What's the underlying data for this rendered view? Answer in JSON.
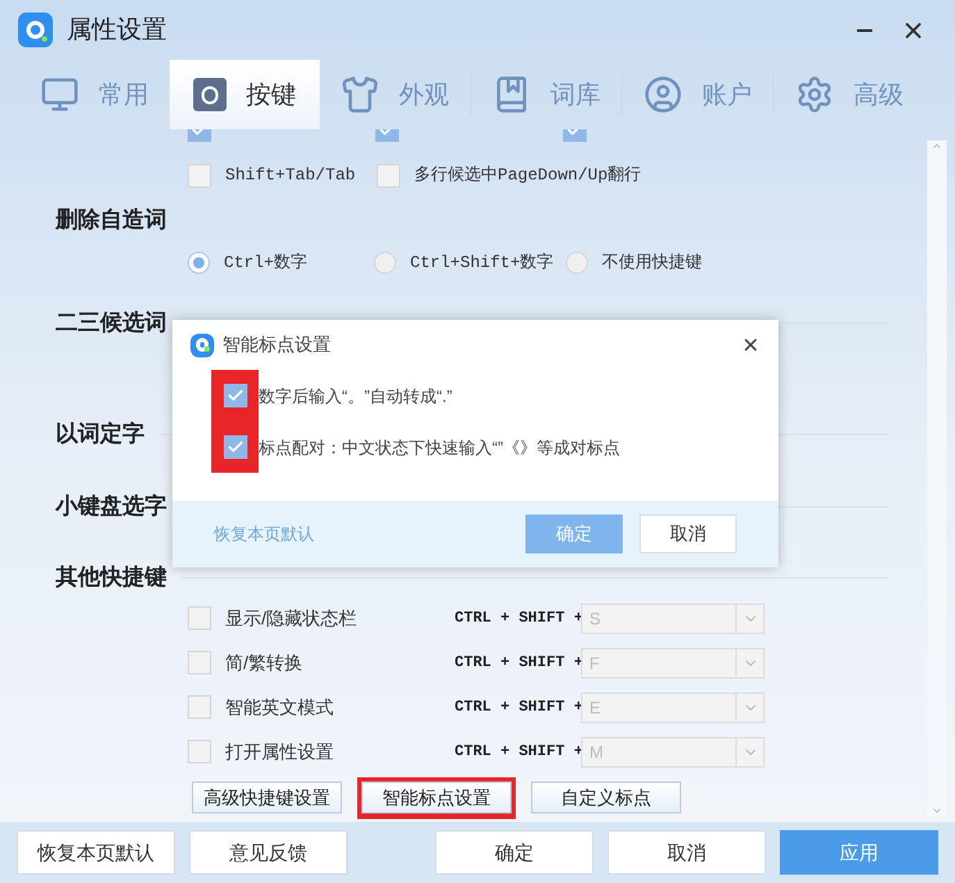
{
  "window": {
    "title": "属性设置"
  },
  "tabs": [
    {
      "label": "常用",
      "kind": "monitor",
      "selected": false
    },
    {
      "label": "按键",
      "kind": "keys",
      "selected": true
    },
    {
      "label": "外观",
      "kind": "theme",
      "selected": false
    },
    {
      "label": "词库",
      "kind": "dictionary",
      "selected": false
    },
    {
      "label": "账户",
      "kind": "account",
      "selected": false
    },
    {
      "label": "高级",
      "kind": "advanced",
      "selected": false
    }
  ],
  "cut_row": [
    {
      "checked": true
    },
    {
      "checked": true
    },
    {
      "checked": true
    }
  ],
  "hotkey_row": [
    {
      "label": "Shift+Tab/Tab",
      "checked": false
    },
    {
      "label": "多行候选中PageDown/Up翻行",
      "checked": false
    }
  ],
  "sections": [
    {
      "title": "删除自造词",
      "options": [
        {
          "label": "Ctrl+数字",
          "selected": true
        },
        {
          "label": "Ctrl+Shift+数字",
          "selected": false
        },
        {
          "label": "不使用快捷键",
          "selected": false
        }
      ]
    },
    {
      "title": "二三候选词"
    },
    {
      "title": "以词定字"
    },
    {
      "title": "小键盘选字"
    },
    {
      "title": "其他快捷键"
    }
  ],
  "shortcuts": [
    {
      "label": "显示/隐藏状态栏",
      "checked": false,
      "modifier": "CTRL + SHIFT +",
      "key": "S"
    },
    {
      "label": "简/繁转换",
      "checked": false,
      "modifier": "CTRL + SHIFT +",
      "key": "F"
    },
    {
      "label": "智能英文模式",
      "checked": false,
      "modifier": "CTRL + SHIFT +",
      "key": "E"
    },
    {
      "label": "打开属性设置",
      "checked": false,
      "modifier": "CTRL + SHIFT +",
      "key": "M"
    }
  ],
  "action_buttons": [
    {
      "label": "高级快捷键设置",
      "highlighted": false
    },
    {
      "label": "智能标点设置",
      "highlighted": true
    },
    {
      "label": "自定义标点",
      "highlighted": false
    }
  ],
  "dialog": {
    "title": "智能标点设置",
    "options_highlighted": true,
    "options": [
      {
        "label": "数字后输入“。”自动转成“.”",
        "checked": true
      },
      {
        "label": "标点配对：中文状态下快速输入“”《》等成对标点",
        "checked": true
      }
    ],
    "reset_link": "恢复本页默认",
    "buttons": [
      {
        "label": "确定",
        "primary": true
      },
      {
        "label": "取消",
        "primary": false
      }
    ]
  },
  "footer_buttons": [
    {
      "label": "恢复本页默认",
      "primary": false
    },
    {
      "label": "意见反馈",
      "primary": false
    },
    {
      "label": "确定",
      "primary": false
    },
    {
      "label": "取消",
      "primary": false
    },
    {
      "label": "应用",
      "primary": true
    }
  ]
}
